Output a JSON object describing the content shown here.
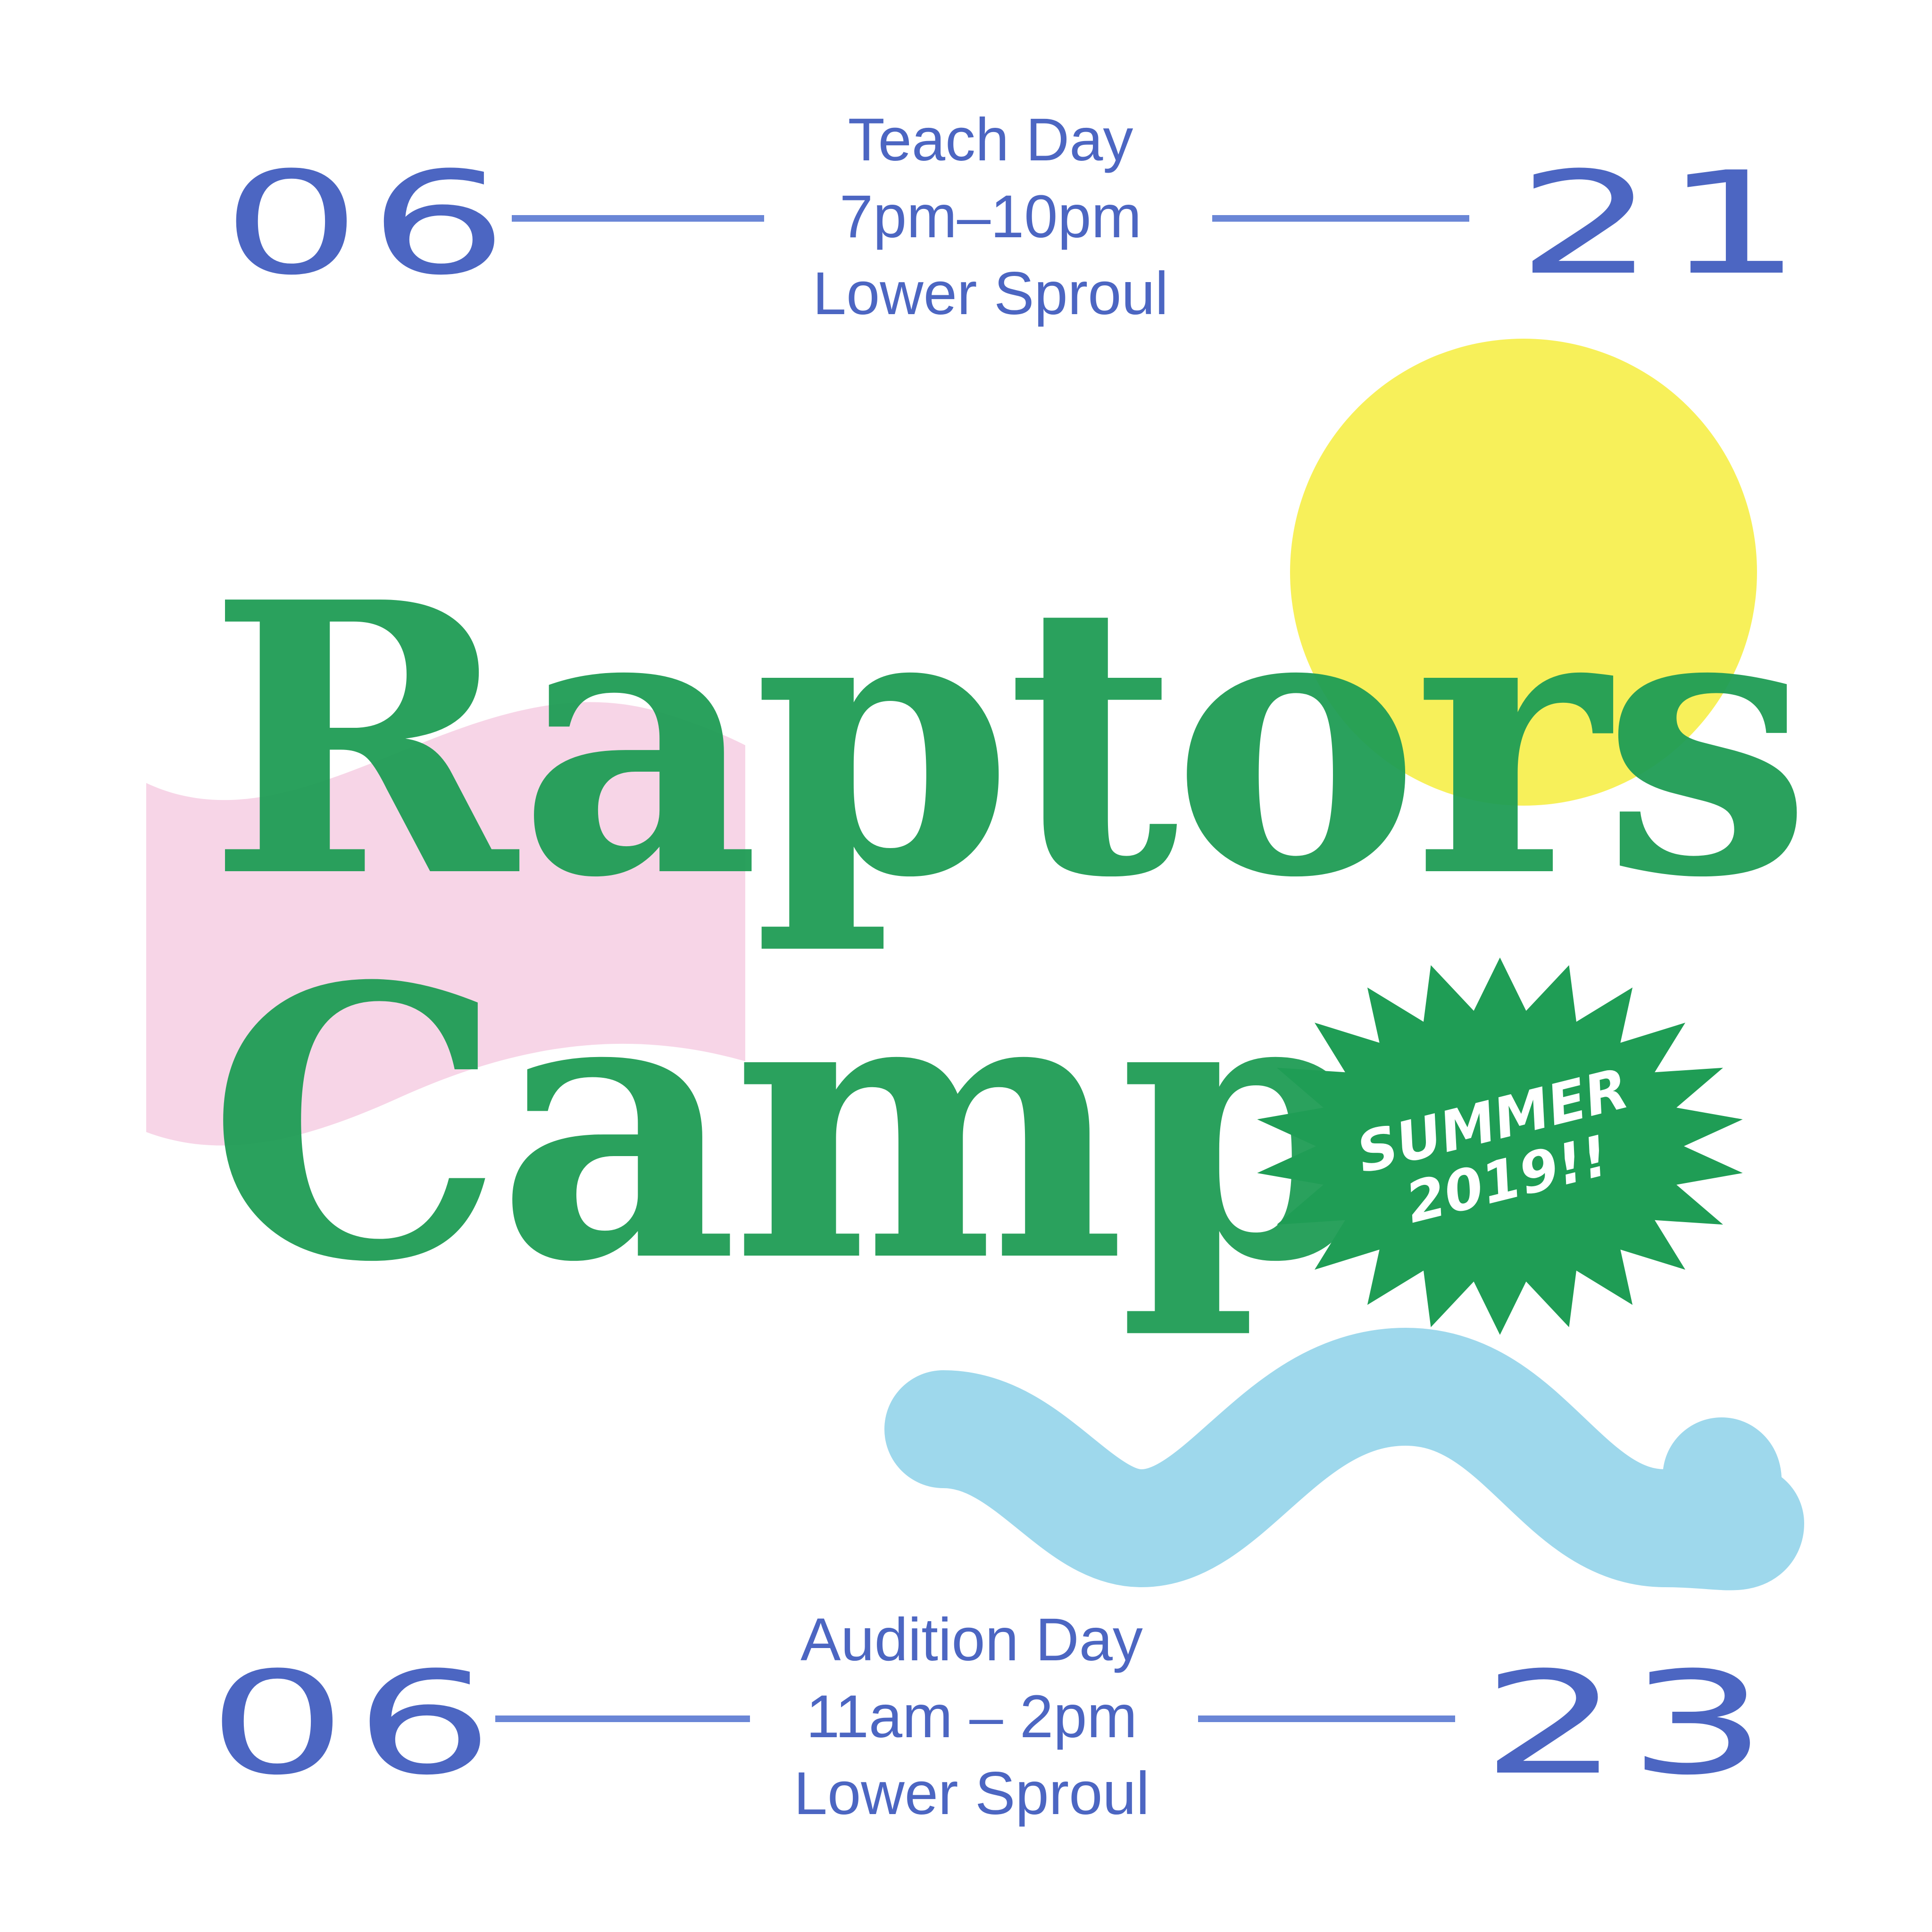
{
  "top_event": {
    "month": "06",
    "day": "21",
    "title": "Teach Day",
    "time": "7pm–10pm",
    "location": "Lower Sproul"
  },
  "bottom_event": {
    "month": "06",
    "day": "23",
    "title": "Audition Day",
    "time": "11am – 2pm",
    "location": "Lower Sproul"
  },
  "headline": {
    "line1": "Raptors",
    "line2": "Camp"
  },
  "badge": {
    "line1": "SUMMER",
    "line2": "2019!!"
  },
  "colors": {
    "background": "#ffffff",
    "text_blue": "#4c66c2",
    "title_green": "#1f9d55",
    "sun_yellow": "#f7f05a",
    "ribbon_pink": "#f7d3e6",
    "wave_blue": "#9ed8ec"
  },
  "icons": [
    "sun-shape",
    "pink-ribbon-shape",
    "starburst-badge",
    "blue-wave-shape"
  ]
}
